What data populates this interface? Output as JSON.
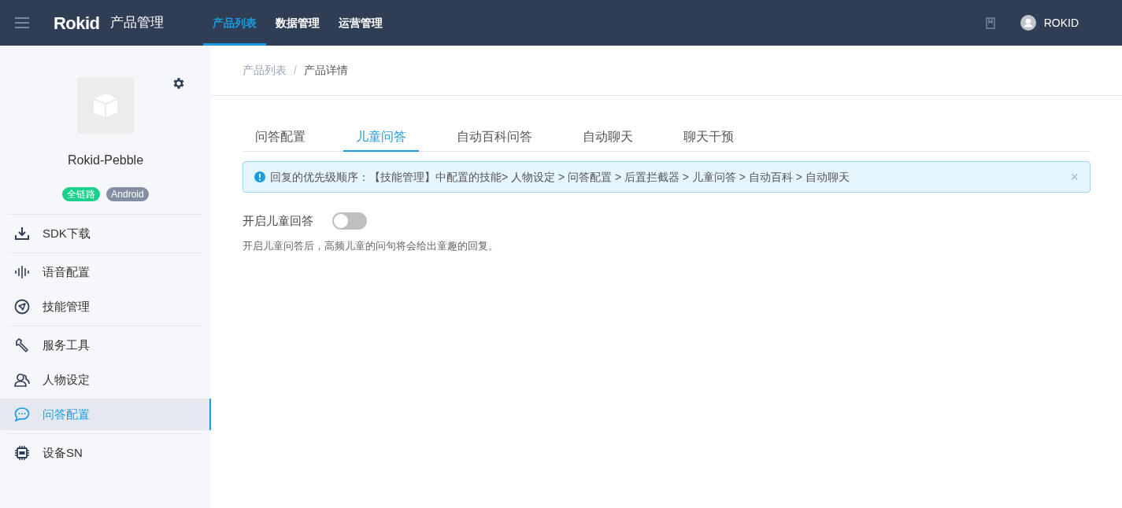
{
  "header": {
    "logo": "Rokid",
    "title": "产品管理",
    "nav": [
      {
        "label": "产品列表",
        "selected": true
      },
      {
        "label": "数据管理",
        "selected": false
      },
      {
        "label": "运营管理",
        "selected": false
      }
    ],
    "user": "ROKID"
  },
  "sidebar": {
    "product_name": "Rokid-Pebble",
    "badges": [
      {
        "label": "全链路",
        "color": "#19d18b"
      },
      {
        "label": "Android",
        "color": "#8390a3"
      }
    ],
    "groups": [
      [
        {
          "kind": "download",
          "label": "SDK下载",
          "selected": false
        }
      ],
      [
        {
          "kind": "voice",
          "label": "语音配置",
          "selected": false
        },
        {
          "kind": "navigate",
          "label": "技能管理",
          "selected": false
        }
      ],
      [
        {
          "kind": "wrench",
          "label": "服务工具",
          "selected": false
        },
        {
          "kind": "people",
          "label": "人物设定",
          "selected": false
        },
        {
          "kind": "chat",
          "label": "问答配置",
          "selected": true
        }
      ],
      [
        {
          "kind": "chip",
          "label": "设备SN",
          "selected": false
        }
      ]
    ]
  },
  "breadcrumb": [
    "产品列表",
    "产品详情"
  ],
  "breadcrumb_separator": "/",
  "tabs": [
    {
      "label": "问答配置",
      "selected": false
    },
    {
      "label": "儿童问答",
      "selected": true
    },
    {
      "label": "自动百科问答",
      "selected": false
    },
    {
      "label": "自动聊天",
      "selected": false
    },
    {
      "label": "聊天干预",
      "selected": false
    }
  ],
  "alert": {
    "text": "回复的优先级顺序：【技能管理】中配置的技能> 人物设定 > 问答配置 > 后置拦截器 > 儿童问答 > 自动百科 > 自动聊天",
    "close": "×"
  },
  "setting": {
    "label": "开启儿童回答",
    "on": false,
    "description": "开启儿童问答后，高频儿童的问句将会给出童趣的回复。"
  }
}
